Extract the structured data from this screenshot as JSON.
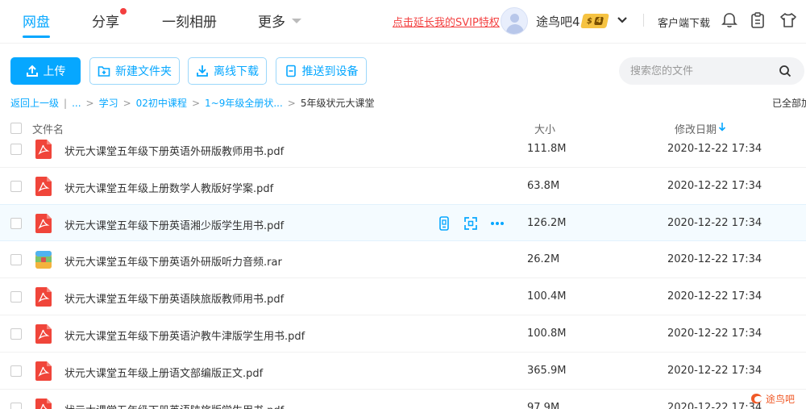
{
  "nav": {
    "tabs": [
      {
        "label": "网盘",
        "active": true
      },
      {
        "label": "分享"
      },
      {
        "label": "一刻相册"
      },
      {
        "label": "更多"
      }
    ]
  },
  "header": {
    "svip_link": "点击延长我的SVIP特权",
    "username": "途鸟吧4",
    "vip_symbol": "$",
    "vip_level": "4",
    "client_download": "客户端下载"
  },
  "toolbar": {
    "upload": "上传",
    "new_folder": "新建文件夹",
    "offline_download": "离线下载",
    "push_device": "推送到设备"
  },
  "search": {
    "placeholder": "搜索您的文件"
  },
  "breadcrumb": {
    "back": "返回上一级",
    "ellipsis": "...",
    "items": [
      "学习",
      "02初中课程",
      "1~9年级全册状...",
      "5年级状元大课堂"
    ]
  },
  "status": {
    "loaded": "已全部加载"
  },
  "table": {
    "col_name": "文件名",
    "col_size": "大小",
    "col_date": "修改日期",
    "rows": [
      {
        "name": "状元大课堂五年级下册英语外研版教师用书.pdf",
        "size": "111.8M",
        "date": "2020-12-22 17:34",
        "type": "pdf"
      },
      {
        "name": "状元大课堂五年级上册数学人教版好学案.pdf",
        "size": "63.8M",
        "date": "2020-12-22 17:34",
        "type": "pdf"
      },
      {
        "name": "状元大课堂五年级下册英语湘少版学生用书.pdf",
        "size": "126.2M",
        "date": "2020-12-22 17:34",
        "type": "pdf",
        "hover": true
      },
      {
        "name": "状元大课堂五年级下册英语外研版听力音频.rar",
        "size": "26.2M",
        "date": "2020-12-22 17:34",
        "type": "rar"
      },
      {
        "name": "状元大课堂五年级下册英语陕旅版教师用书.pdf",
        "size": "100.4M",
        "date": "2020-12-22 17:34",
        "type": "pdf"
      },
      {
        "name": "状元大课堂五年级下册英语沪教牛津版学生用书.pdf",
        "size": "100.8M",
        "date": "2020-12-22 17:34",
        "type": "pdf"
      },
      {
        "name": "状元大课堂五年级上册语文部编版正文.pdf",
        "size": "365.9M",
        "date": "2020-12-22 17:34",
        "type": "pdf"
      },
      {
        "name": "状元大课堂五年级下册英语陕旅版学生用书.pdf",
        "size": "97.9M",
        "date": "2020-12-22 17:34",
        "type": "pdf"
      }
    ]
  },
  "watermark": {
    "text": "途鸟吧"
  },
  "colors": {
    "accent": "#06a7ff",
    "danger": "#f33f3f",
    "vip": "#f6c342"
  }
}
